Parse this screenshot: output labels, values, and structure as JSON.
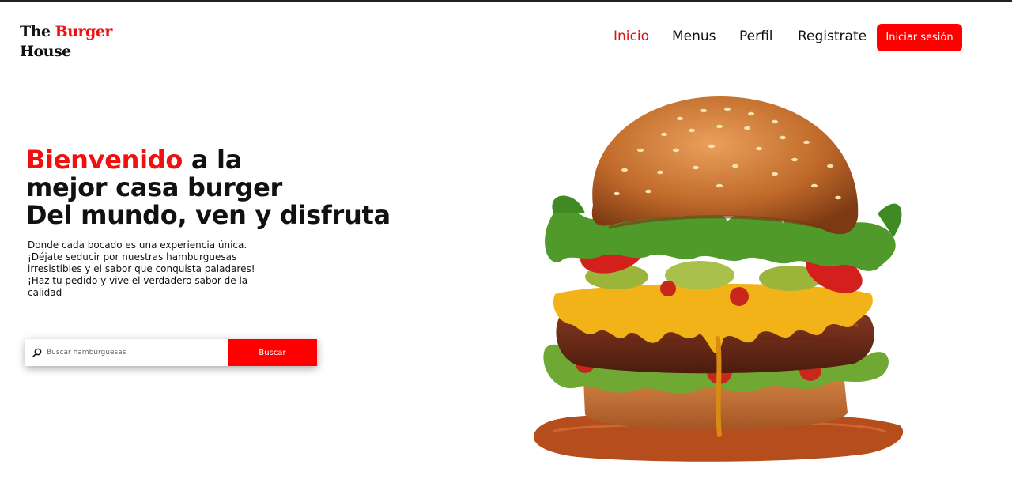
{
  "brand": {
    "part1": "The",
    "part2": "Burger",
    "part3": "House",
    "accent_color": "#ef1010"
  },
  "nav": {
    "items": [
      {
        "label": "Inicio",
        "active": true
      },
      {
        "label": "Menus",
        "active": false
      },
      {
        "label": "Perfil",
        "active": false
      },
      {
        "label": "Registrate",
        "active": false
      }
    ],
    "login_label": "Iniciar sesión",
    "login_color": "#ff0000"
  },
  "hero": {
    "title_highlight": "Bienvenido",
    "title_rest1": " a la",
    "title_line2": "mejor casa burger",
    "title_line3": "Del mundo, ven y disfruta",
    "subtitle": "Donde cada bocado es una experiencia única. ¡Déjate seducir por nuestras hamburguesas irresistibles y el sabor que conquista paladares! ¡Haz tu pedido y vive el verdadero sabor de la calidad"
  },
  "search": {
    "icon": "search-icon",
    "placeholder": "Buscar hamburguesas",
    "value": "",
    "button_label": "Buscar"
  },
  "hero_image": {
    "icon": "burger-illustration"
  }
}
